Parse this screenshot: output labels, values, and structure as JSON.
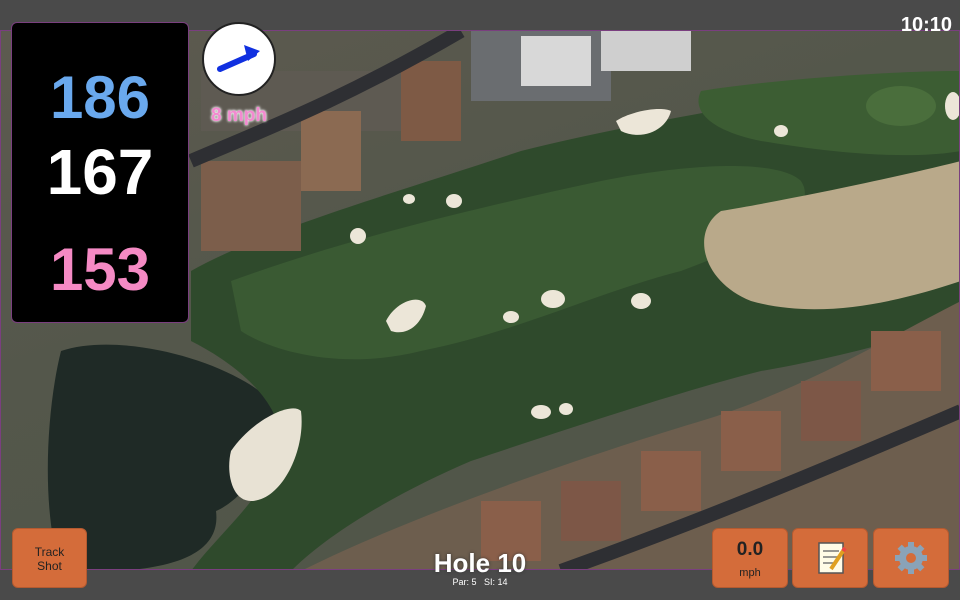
{
  "status": {
    "time": "10:10"
  },
  "yardage": {
    "back": "186",
    "center": "167",
    "front": "153"
  },
  "wind": {
    "speed_label": "8 mph",
    "arrow_icon": "arrow-right-up-icon",
    "arrow_color": "#1030e0"
  },
  "hole": {
    "title": "Hole 10",
    "par_label": "Par: 5",
    "si_label": "SI: 14"
  },
  "buttons": {
    "track_shot_line1": "Track",
    "track_shot_line2": "Shot",
    "speed_value": "0.0",
    "speed_unit": "mph",
    "notes_icon": "notepad-icon",
    "settings_icon": "gear-icon"
  },
  "colors": {
    "button": "#d46c3a",
    "back_yardage": "#6aa9ee",
    "front_yardage": "#f58ac4",
    "panel_border": "#7a3f7f"
  }
}
